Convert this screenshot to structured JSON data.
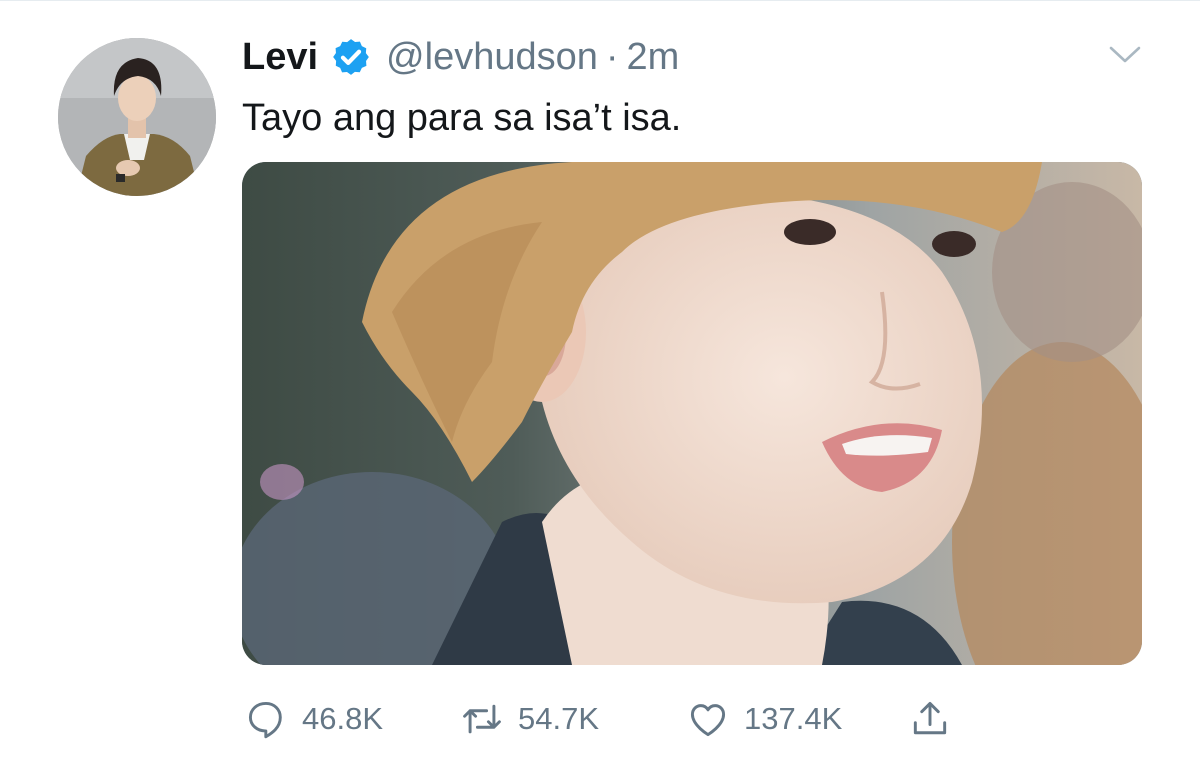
{
  "tweet": {
    "author": {
      "name": "Levi",
      "handle": "@levhudson",
      "verified": true
    },
    "separator": "·",
    "time": "2m",
    "text": "Tayo ang para sa isa’t isa.",
    "stats": {
      "replies": "46.8K",
      "retweets": "54.7K",
      "likes": "137.4K"
    }
  },
  "icons": {
    "verified": "verified-badge-icon",
    "chevron": "chevron-down-icon",
    "reply": "reply-icon",
    "retweet": "retweet-icon",
    "like": "heart-icon",
    "share": "share-icon"
  },
  "colors": {
    "name": "#14171a",
    "meta": "#657786",
    "verified": "#1da1f2",
    "icon": "#657786"
  }
}
